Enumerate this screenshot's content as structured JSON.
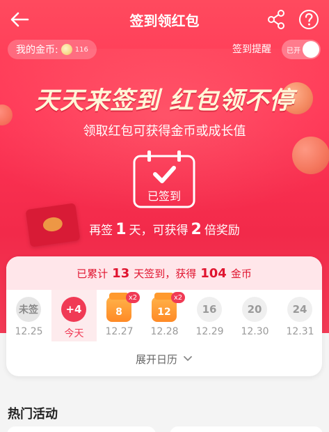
{
  "header": {
    "title": "签到领红包",
    "back_icon": "back-arrow-icon",
    "share_icon": "share-icon",
    "help_icon": "help-icon"
  },
  "coins": {
    "label": "我的金币:",
    "count": "116"
  },
  "reminder": {
    "label": "签到提醒",
    "toggle_label": "已开",
    "on": true
  },
  "banner": {
    "slogan": "天天来签到 红包领不停",
    "subtitle": "领取红包可获得金币或成长值",
    "calendar_label": "已签到"
  },
  "again": {
    "prefix": "再签",
    "days": "1",
    "middle": "天，可获得",
    "multiplier": "2",
    "suffix": "倍奖励"
  },
  "summary": {
    "prefix": "已累计",
    "days": "13",
    "middle": "天签到，获得",
    "coins": "104",
    "suffix": "金币"
  },
  "days": [
    {
      "badge": "未签",
      "date": "12.25",
      "kind": "missed"
    },
    {
      "badge": "+4",
      "date": "今天",
      "kind": "today"
    },
    {
      "badge": "8",
      "date": "12.27",
      "kind": "gift",
      "tag": "x2"
    },
    {
      "badge": "12",
      "date": "12.28",
      "kind": "gift",
      "tag": "x2"
    },
    {
      "badge": "16",
      "date": "12.29",
      "kind": "future"
    },
    {
      "badge": "20",
      "date": "12.30",
      "kind": "future"
    },
    {
      "badge": "24",
      "date": "12.31",
      "kind": "future"
    }
  ],
  "expand": {
    "label": "展开日历"
  },
  "hot": {
    "title": "热门活动"
  },
  "colors": {
    "brand_red": "#f03a55",
    "gift_orange": "#ff8a26",
    "summary_bg": "#ffe6ea"
  }
}
